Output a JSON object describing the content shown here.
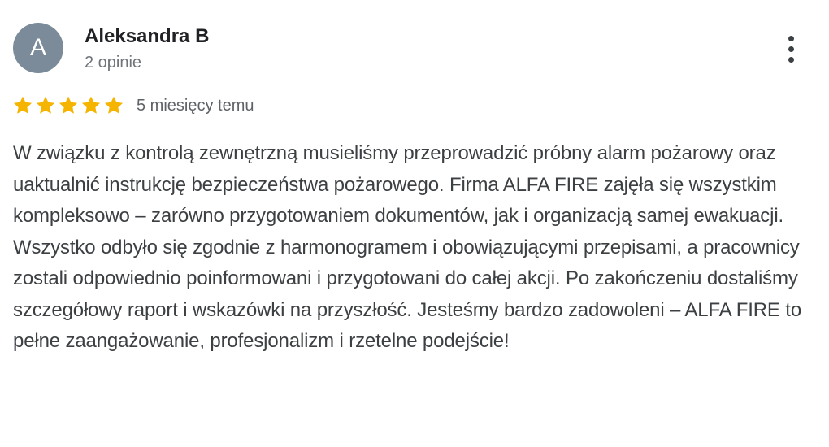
{
  "author": {
    "avatar_letter": "A",
    "name": "Aleksandra B",
    "review_count": "2 opinie"
  },
  "menu": {
    "icon": "more-vertical-icon"
  },
  "rating": {
    "stars": 5,
    "max_stars": 5,
    "star_color": "#f4b400",
    "date": "5 miesięcy temu"
  },
  "review": {
    "text": "W związku z kontrolą zewnętrzną musieliśmy przeprowadzić próbny alarm pożarowy oraz uaktualnić instrukcję bezpieczeństwa pożarowego. Firma ALFA FIRE zajęła się wszystkim kompleksowo – zarówno przygotowaniem dokumentów, jak i organizacją samej ewakuacji. Wszystko odbyło się zgodnie z harmonogramem i obowiązującymi przepisami, a pracownicy zostali odpowiednio poinformowani i przygotowani do całej akcji. Po zakończeniu dostaliśmy szczegółowy raport i wskazówki na przyszłość. Jesteśmy bardzo zadowoleni – ALFA FIRE to pełne zaangażowanie, profesjonalizm i rzetelne podejście!"
  },
  "colors": {
    "avatar_bg": "#7b8b9a",
    "name": "#202124",
    "secondary_text": "#70757a",
    "body_text": "#3c4043"
  }
}
